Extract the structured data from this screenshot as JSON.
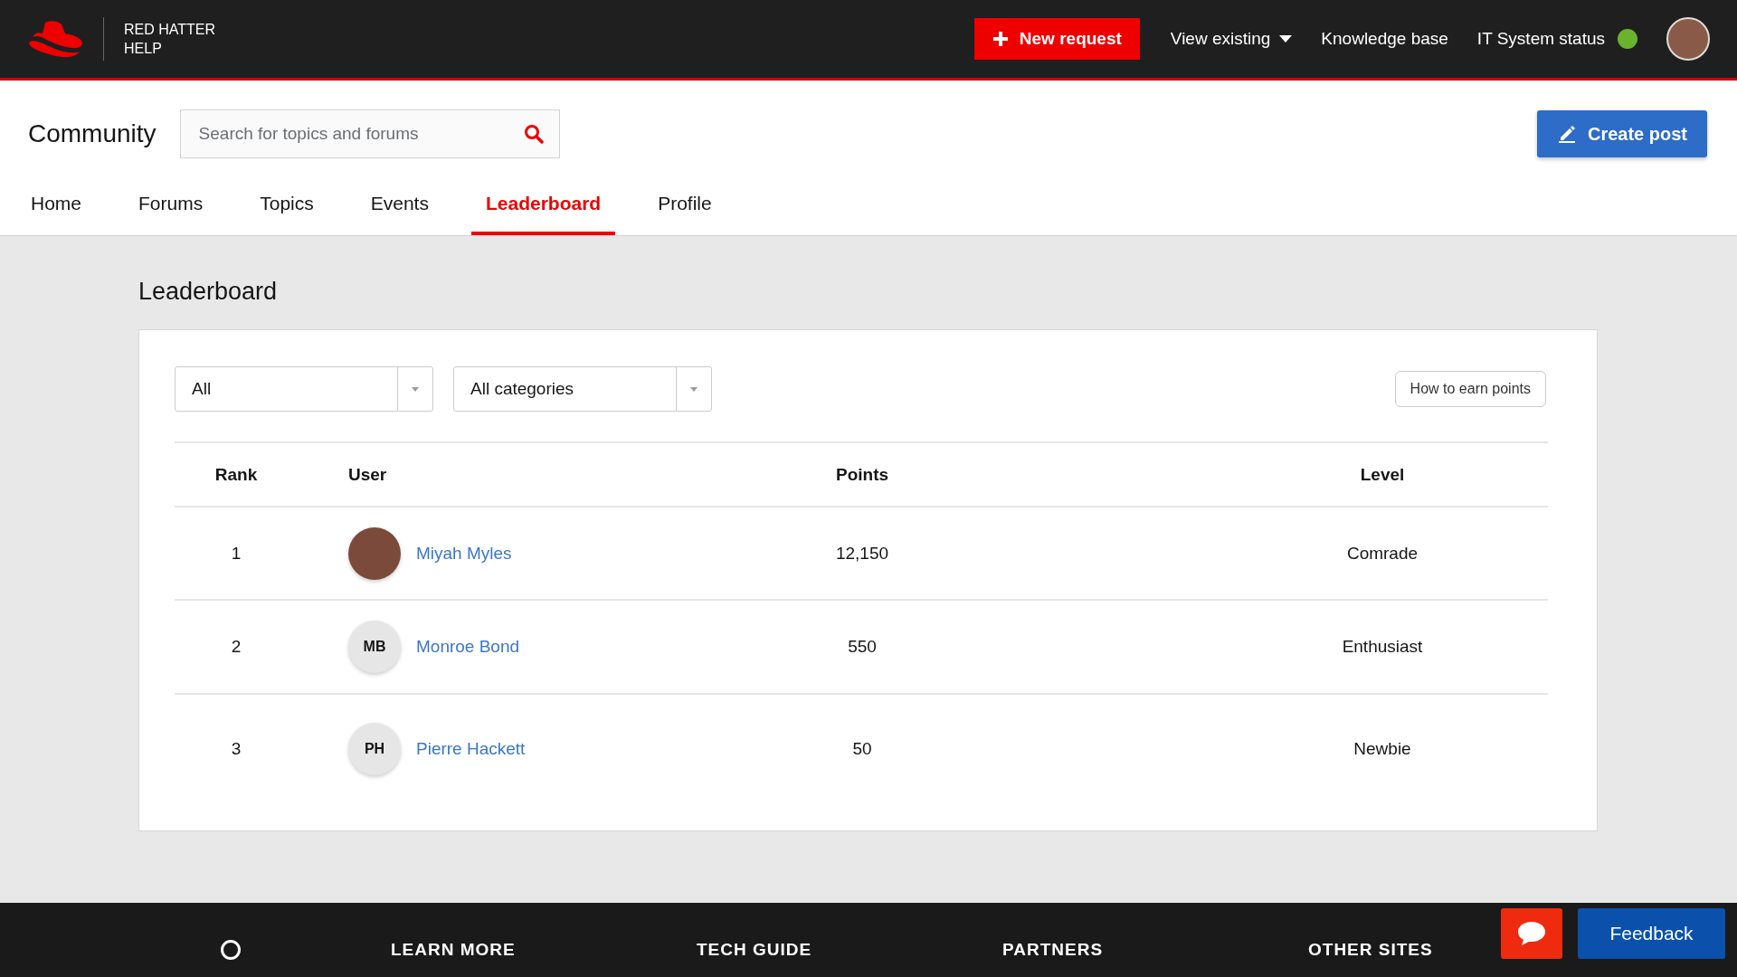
{
  "header": {
    "brand": [
      "RED HATTER",
      "HELP"
    ],
    "new_request": "New request",
    "nav": [
      {
        "label": "View existing",
        "kind": "dropdown"
      },
      {
        "label": "Knowledge base",
        "kind": "link"
      },
      {
        "label": "IT System status",
        "kind": "status",
        "color": "#6ab42d"
      }
    ]
  },
  "community": {
    "title": "Community",
    "search": {
      "placeholder": "Search for topics and forums"
    },
    "create_post": "Create post"
  },
  "tabs": [
    {
      "label": "Home",
      "selected": false
    },
    {
      "label": "Forums",
      "selected": false
    },
    {
      "label": "Topics",
      "selected": false
    },
    {
      "label": "Events",
      "selected": false
    },
    {
      "label": "Leaderboard",
      "selected": true
    },
    {
      "label": "Profile",
      "selected": false
    }
  ],
  "page_title": "Leaderboard",
  "filters": [
    {
      "value": "All"
    },
    {
      "value": "All categories"
    }
  ],
  "how_to_earn": "How to earn points",
  "table": {
    "columns": [
      "Rank",
      "User",
      "Points",
      "Level"
    ],
    "rows": [
      {
        "rank": "1",
        "avatar": {
          "kind": "photo"
        },
        "user": "Miyah Myles",
        "points": "12,150",
        "level": "Comrade"
      },
      {
        "rank": "2",
        "avatar": {
          "kind": "initials",
          "initials": "MB"
        },
        "user": "Monroe Bond",
        "points": "550",
        "level": "Enthusiast"
      },
      {
        "rank": "3",
        "avatar": {
          "kind": "initials",
          "initials": "PH"
        },
        "user": "Pierre Hackett",
        "points": "50",
        "level": "Newbie"
      }
    ]
  },
  "footer": {
    "headings": [
      "LEARN MORE",
      "TECH GUIDE",
      "PARTNERS",
      "OTHER SITES"
    ],
    "feedback": "Feedback"
  }
}
